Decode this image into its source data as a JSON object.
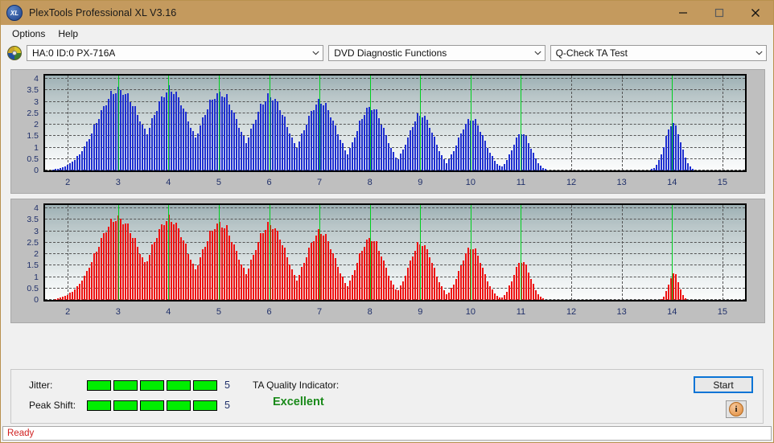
{
  "window": {
    "title": "PlexTools Professional XL V3.16",
    "app_icon": "xl-logo-icon",
    "minimize": "minimize-icon",
    "maximize": "maximize-icon",
    "close": "close-icon"
  },
  "menu": {
    "items": [
      "Options",
      "Help"
    ]
  },
  "toolbar": {
    "device_icon": "disc-drive-icon",
    "device": "HA:0 ID:0  PX-716A",
    "function": "DVD Diagnostic Functions",
    "test": "Q-Check TA Test",
    "dropdown_arrow": "chevron-down-icon"
  },
  "results": {
    "jitter_label": "Jitter:",
    "jitter_value": "5",
    "jitter_blocks": 5,
    "peak_shift_label": "Peak Shift:",
    "peak_shift_value": "5",
    "peak_shift_blocks": 5,
    "quality_label": "TA Quality Indicator:",
    "quality_value": "Excellent",
    "quality_color": "#1a8a1a",
    "start_label": "Start",
    "info_label": "i"
  },
  "statusbar": {
    "text": "Ready",
    "color": "#d02020"
  },
  "chart_data": [
    {
      "id": "chart-top",
      "type": "bar",
      "title": "",
      "series_color": "#1f2fd0",
      "marker_color": "#00d020",
      "xlabel": "",
      "ylabel": "",
      "xlim": [
        1.55,
        15.45
      ],
      "ylim": [
        0,
        4.15
      ],
      "yticks": [
        0,
        0.5,
        1,
        1.5,
        2,
        2.5,
        3,
        3.5,
        4
      ],
      "ytick_labels": [
        "0",
        "0.5",
        "1",
        "1.5",
        "2",
        "2.5",
        "3",
        "3.5",
        "4"
      ],
      "xticks": [
        2,
        3,
        4,
        5,
        6,
        7,
        8,
        9,
        10,
        11,
        12,
        13,
        14,
        15
      ],
      "xtick_labels": [
        "2",
        "3",
        "4",
        "5",
        "6",
        "7",
        "8",
        "9",
        "10",
        "11",
        "12",
        "13",
        "14",
        "15"
      ],
      "grid": true,
      "markers": [
        3,
        4,
        5,
        6,
        7,
        8,
        9,
        10,
        11,
        14
      ],
      "peaks": [
        {
          "center": 3.0,
          "height": 3.75,
          "width": 0.62
        },
        {
          "center": 4.02,
          "height": 3.75,
          "width": 0.52
        },
        {
          "center": 5.0,
          "height": 3.6,
          "width": 0.52
        },
        {
          "center": 6.0,
          "height": 3.45,
          "width": 0.48
        },
        {
          "center": 7.0,
          "height": 3.2,
          "width": 0.45
        },
        {
          "center": 8.0,
          "height": 2.95,
          "width": 0.4
        },
        {
          "center": 9.0,
          "height": 2.6,
          "width": 0.36
        },
        {
          "center": 10.0,
          "height": 2.4,
          "width": 0.36
        },
        {
          "center": 11.0,
          "height": 1.75,
          "width": 0.26
        },
        {
          "center": 14.0,
          "height": 2.2,
          "width": 0.22
        }
      ]
    },
    {
      "id": "chart-bottom",
      "type": "bar",
      "title": "",
      "series_color": "#ee1111",
      "marker_color": "#00d020",
      "xlabel": "",
      "ylabel": "",
      "xlim": [
        1.55,
        15.45
      ],
      "ylim": [
        0,
        4.15
      ],
      "yticks": [
        0,
        0.5,
        1,
        1.5,
        2,
        2.5,
        3,
        3.5,
        4
      ],
      "ytick_labels": [
        "0",
        "0.5",
        "1",
        "1.5",
        "2",
        "2.5",
        "3",
        "3.5",
        "4"
      ],
      "xticks": [
        2,
        3,
        4,
        5,
        6,
        7,
        8,
        9,
        10,
        11,
        12,
        13,
        14,
        15
      ],
      "xtick_labels": [
        "2",
        "3",
        "4",
        "5",
        "6",
        "7",
        "8",
        "9",
        "10",
        "11",
        "12",
        "13",
        "14",
        "15"
      ],
      "grid": true,
      "markers": [
        3,
        4,
        5,
        6,
        7,
        8,
        9,
        10,
        11,
        14
      ],
      "peaks": [
        {
          "center": 2.98,
          "height": 3.8,
          "width": 0.6
        },
        {
          "center": 4.0,
          "height": 3.75,
          "width": 0.52
        },
        {
          "center": 5.0,
          "height": 3.55,
          "width": 0.5
        },
        {
          "center": 6.0,
          "height": 3.5,
          "width": 0.46
        },
        {
          "center": 7.0,
          "height": 3.15,
          "width": 0.42
        },
        {
          "center": 8.0,
          "height": 2.85,
          "width": 0.38
        },
        {
          "center": 9.0,
          "height": 2.65,
          "width": 0.34
        },
        {
          "center": 10.0,
          "height": 2.45,
          "width": 0.32
        },
        {
          "center": 11.0,
          "height": 1.8,
          "width": 0.24
        },
        {
          "center": 14.02,
          "height": 1.25,
          "width": 0.14
        }
      ]
    }
  ]
}
